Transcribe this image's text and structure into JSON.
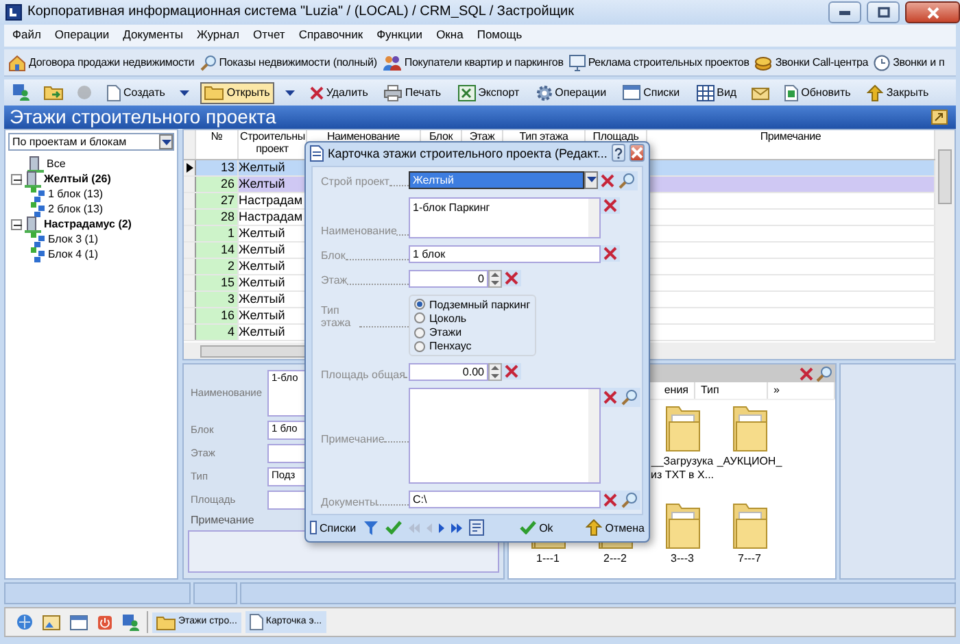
{
  "window": {
    "title": "Корпоративная информационная система \"Luzia\" / (LOCAL) / CRM_SQL / Застройщик"
  },
  "menu": [
    "Файл",
    "Операции",
    "Документы",
    "Журнал",
    "Отчет",
    "Справочник",
    "Функции",
    "Окна",
    "Помощь"
  ],
  "shortcuts": [
    {
      "label": "Договора продажи недвижимости"
    },
    {
      "label": "Показы недвижимости (полный)"
    },
    {
      "label": "Покупатели квартир и паркингов"
    },
    {
      "label": "Реклама строительных проектов"
    },
    {
      "label": "Звонки Call-центра"
    },
    {
      "label": "Звонки и п"
    }
  ],
  "toolbar": [
    {
      "kind": "icon",
      "disabled": false
    },
    {
      "kind": "icon",
      "disabled": false
    },
    {
      "kind": "icon",
      "disabled": true
    },
    {
      "kind": "button",
      "label": "Создать",
      "pressed": false
    },
    {
      "kind": "dropdown"
    },
    {
      "kind": "button",
      "label": "Открыть",
      "pressed": true
    },
    {
      "kind": "dropdown"
    },
    {
      "kind": "button",
      "label": "Удалить",
      "pressed": false
    },
    {
      "kind": "button",
      "label": "Печать",
      "pressed": false
    },
    {
      "kind": "button",
      "label": "Экспорт",
      "pressed": false
    },
    {
      "kind": "button",
      "label": "Операции",
      "pressed": false
    },
    {
      "kind": "button",
      "label": "Списки",
      "pressed": false
    },
    {
      "kind": "button",
      "label": "Вид",
      "pressed": false
    },
    {
      "kind": "icon",
      "disabled": false
    },
    {
      "kind": "button",
      "label": "Обновить",
      "pressed": false
    },
    {
      "kind": "button",
      "label": "Закрыть",
      "pressed": false
    }
  ],
  "section_title": "Этажи строительного проекта",
  "filter": {
    "value": "По проектам и блокам"
  },
  "tree": [
    {
      "label": "Все",
      "bold": false
    },
    {
      "label": "Желтый (26)",
      "bold": true,
      "expanded": true,
      "children": [
        {
          "label": "1 блок (13)",
          "bold": false
        },
        {
          "label": "2 блок (13)",
          "bold": false
        }
      ]
    },
    {
      "label": "Настрадамус (2)",
      "bold": true,
      "expanded": true,
      "children": [
        {
          "label": "Блок 3 (1)",
          "bold": false
        },
        {
          "label": "Блок 4 (1)",
          "bold": false
        }
      ]
    }
  ],
  "grid": {
    "columns": [
      "№",
      "Строительны проект",
      "Наименование",
      "Блок",
      "Этаж",
      "Тип этажа",
      "Площадь",
      "Примечание"
    ],
    "rows": [
      {
        "number": "13",
        "project": "Желтый",
        "selected": true,
        "highlighted": false
      },
      {
        "number": "26",
        "project": "Желтый",
        "selected": false,
        "highlighted": true
      },
      {
        "number": "27",
        "project": "Настрадам",
        "selected": false,
        "highlighted": false
      },
      {
        "number": "28",
        "project": "Настрадам",
        "selected": false,
        "highlighted": false
      },
      {
        "number": "1",
        "project": "Желтый",
        "selected": false,
        "highlighted": false
      },
      {
        "number": "14",
        "project": "Желтый",
        "selected": false,
        "highlighted": false
      },
      {
        "number": "2",
        "project": "Желтый",
        "selected": false,
        "highlighted": false
      },
      {
        "number": "15",
        "project": "Желтый",
        "selected": false,
        "highlighted": false
      },
      {
        "number": "3",
        "project": "Желтый",
        "selected": false,
        "highlighted": false
      },
      {
        "number": "16",
        "project": "Желтый",
        "selected": false,
        "highlighted": false
      },
      {
        "number": "4",
        "project": "Желтый",
        "selected": false,
        "highlighted": false
      }
    ]
  },
  "detail": {
    "fields": [
      {
        "label": "Наименование",
        "value": "1-бло",
        "kind": "memo"
      },
      {
        "label": "Блок",
        "value": "1 бло",
        "kind": "text"
      },
      {
        "label": "Этаж",
        "kind": "text"
      },
      {
        "label": "Тип",
        "value": "Подз",
        "kind": "text"
      },
      {
        "label": "Площадь",
        "kind": "text"
      }
    ],
    "note_label": "Примечание"
  },
  "files": {
    "columns": [
      "ения",
      "Тип",
      "»"
    ],
    "items": [
      {
        "name": "__Загрузука из TXT в X..."
      },
      {
        "name": "_АУКЦИОН_"
      },
      {
        "name": "1---1"
      },
      {
        "name": "2---2"
      },
      {
        "name": "3---3"
      },
      {
        "name": "7---7"
      }
    ]
  },
  "dialog": {
    "title": "Карточка этажи строительного проекта (Редакт...",
    "fields": [
      {
        "kind": "combo",
        "label": "Строй проект",
        "value": "Желтый",
        "lookup": true
      },
      {
        "kind": "memo",
        "label": "Наименование",
        "value": "1-блок Паркинг",
        "lookup": false
      },
      {
        "kind": "text",
        "label": "Блок",
        "value": "1 блок",
        "lookup": false
      },
      {
        "kind": "spin",
        "label": "Этаж",
        "value": "0",
        "lookup": false
      },
      {
        "kind": "radio",
        "label": "Тип этажа",
        "options": [
          {
            "label": "Подземный паркинг",
            "selected": true
          },
          {
            "label": "Цоколь",
            "selected": false
          },
          {
            "label": "Этажи",
            "selected": false
          },
          {
            "label": "Пенхаус",
            "selected": false
          }
        ]
      },
      {
        "kind": "spin",
        "label": "Площадь общая",
        "value": "0.00",
        "lookup": false
      },
      {
        "kind": "bigmemo",
        "label": "Примечание",
        "lookup": true
      },
      {
        "kind": "text",
        "label": "Документы",
        "value": "C:\\",
        "lookup": true
      }
    ],
    "footer": {
      "lists": "Списки",
      "nav": [
        {
          "disabled": true
        },
        {
          "disabled": true
        },
        {
          "disabled": false
        },
        {
          "disabled": false
        }
      ],
      "ok": "Ok",
      "cancel": "Отмена"
    }
  },
  "taskbar": {
    "items": [
      {
        "label": "Этажи стро..."
      },
      {
        "label": "Карточка э..."
      }
    ]
  }
}
